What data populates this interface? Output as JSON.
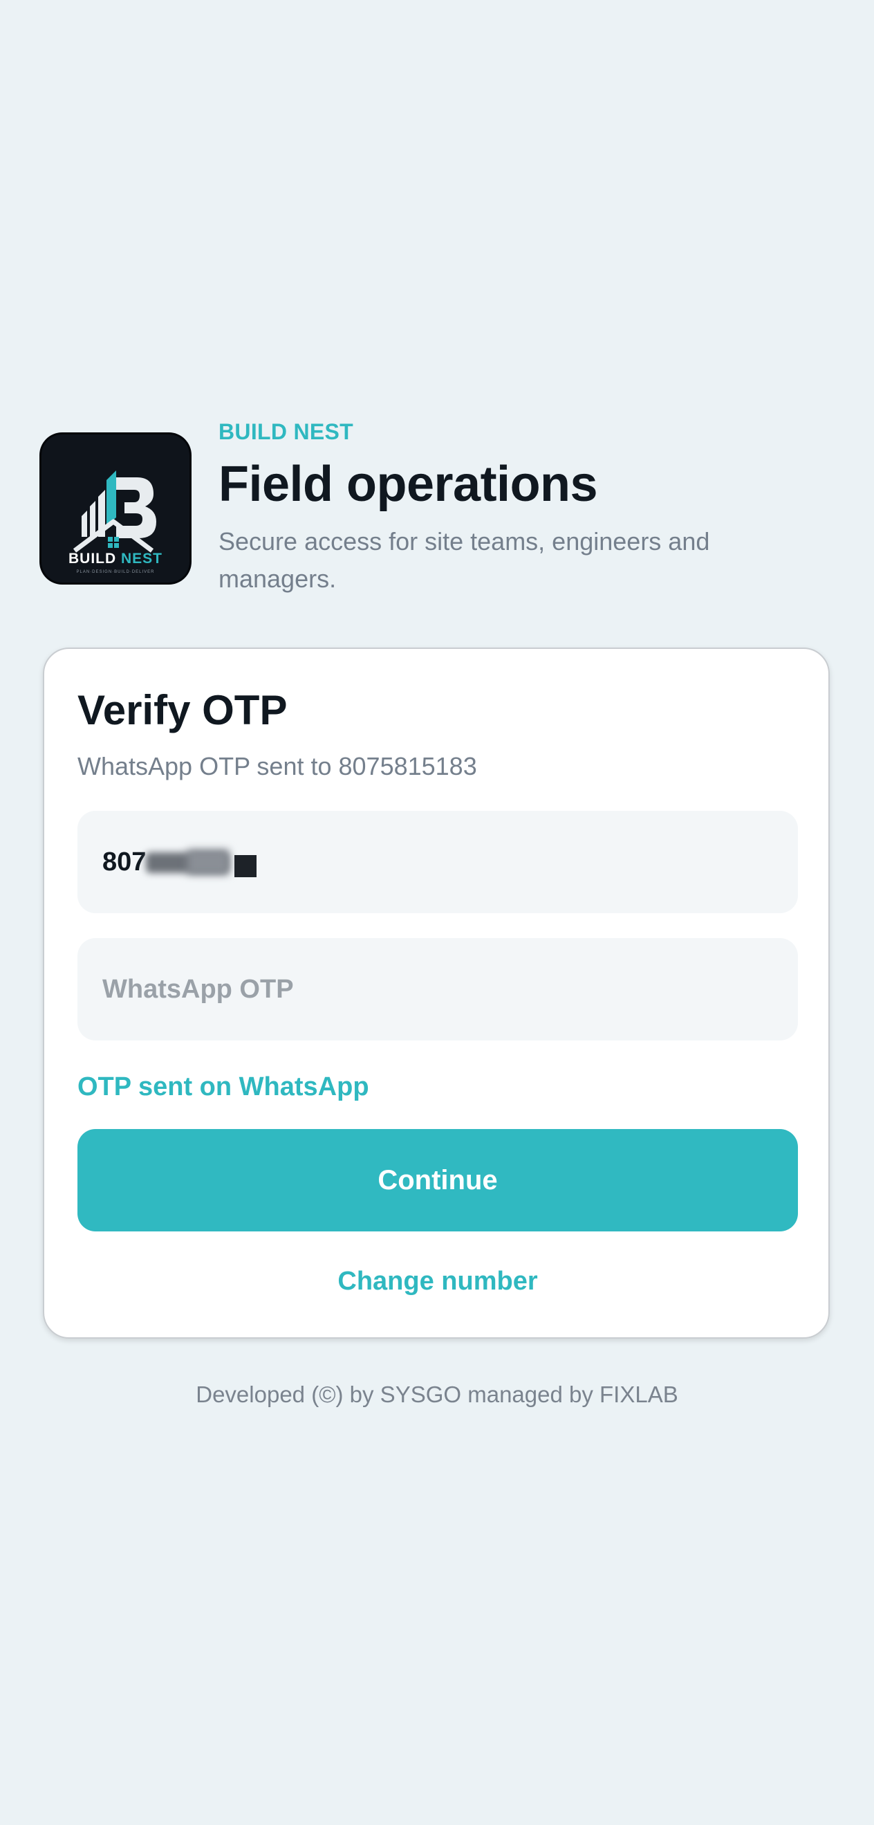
{
  "brand": {
    "eyebrow": "BUILD NEST",
    "logo_text": "BUILD NEST",
    "logo_tagline": "PLAN·DESIGN·BUILD·DELIVER",
    "accent_color": "#2fb8c0"
  },
  "header": {
    "title": "Field operations",
    "subtitle": "Secure access for site teams, engineers and managers."
  },
  "card": {
    "title": "Verify OTP",
    "subtitle": "WhatsApp OTP sent to 8075815183",
    "phone_value_visible": "807",
    "otp_placeholder": "WhatsApp OTP",
    "otp_value": "",
    "status_text": "OTP sent on WhatsApp",
    "continue_label": "Continue",
    "change_number_label": "Change number"
  },
  "footer": {
    "text": "Developed (©) by SYSGO managed by FIXLAB"
  }
}
